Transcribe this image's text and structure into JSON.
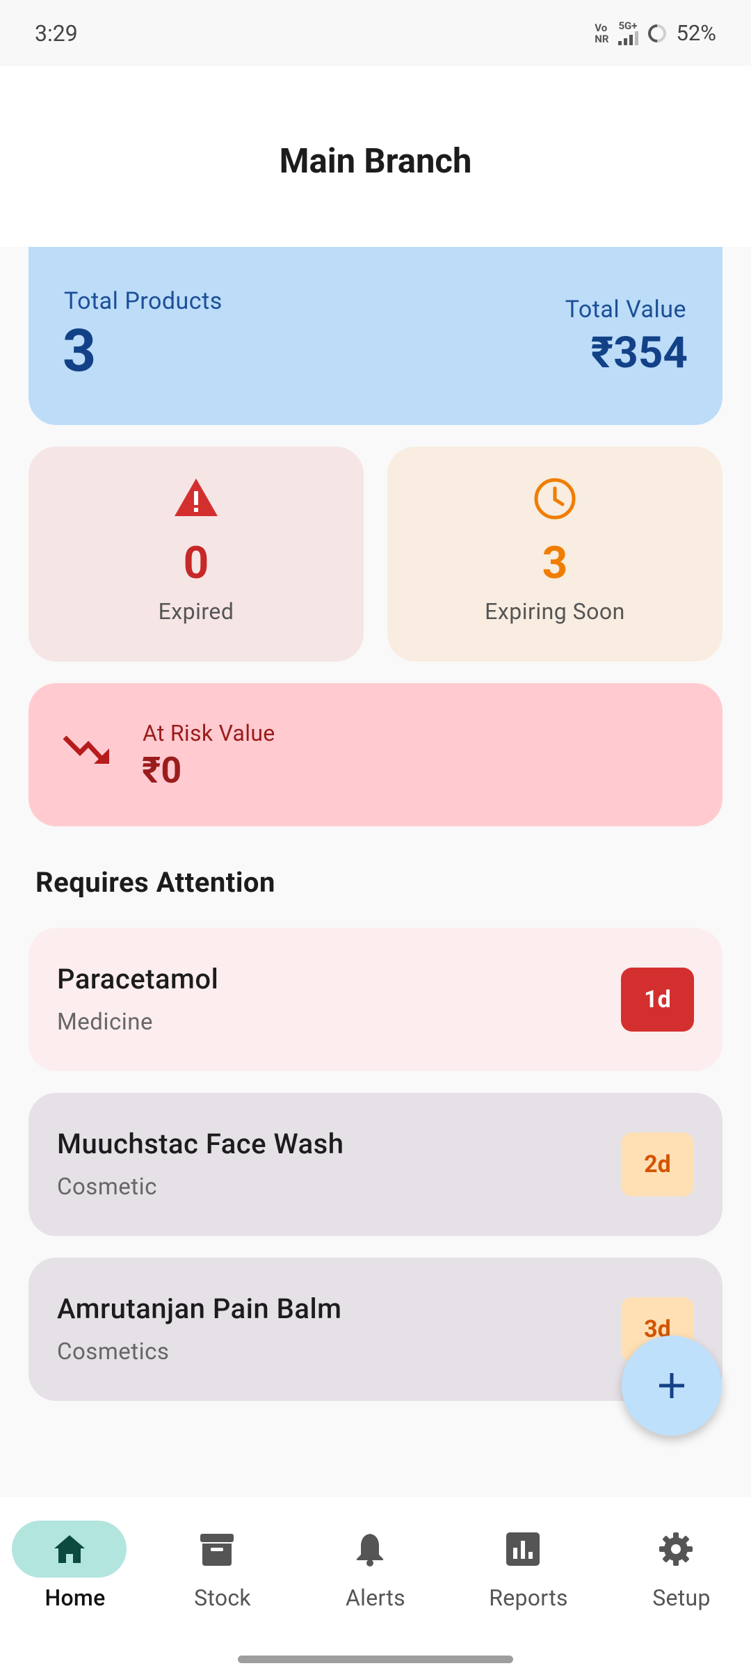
{
  "status_bar": {
    "time": "3:29",
    "net_top": "Vo",
    "net_bottom": "NR",
    "net_type": "5G+",
    "battery": "52%"
  },
  "header": {
    "title": "Main Branch"
  },
  "summary": {
    "total_products_label": "Total Products",
    "total_products": "3",
    "total_value_label": "Total Value",
    "total_value": "₹354"
  },
  "stats": {
    "expired": {
      "value": "0",
      "label": "Expired",
      "icon": "warning-triangle-icon",
      "color": "#c62828"
    },
    "expiring_soon": {
      "value": "3",
      "label": "Expiring Soon",
      "icon": "clock-icon",
      "color": "#ef7d00"
    }
  },
  "at_risk": {
    "label": "At Risk Value",
    "value": "₹0",
    "icon": "trending-down-icon"
  },
  "attention": {
    "title": "Requires Attention",
    "items": [
      {
        "name": "Paracetamol",
        "category": "Medicine",
        "badge": "1d"
      },
      {
        "name": "Muuchstac Face Wash",
        "category": "Cosmetic",
        "badge": "2d"
      },
      {
        "name": "Amrutanjan Pain Balm",
        "category": "Cosmetics",
        "badge": "3d"
      }
    ]
  },
  "fab": {
    "icon": "plus-icon"
  },
  "nav": {
    "items": [
      {
        "label": "Home",
        "icon": "home-icon",
        "active": true
      },
      {
        "label": "Stock",
        "icon": "archive-box-icon",
        "active": false
      },
      {
        "label": "Alerts",
        "icon": "bell-icon",
        "active": false
      },
      {
        "label": "Reports",
        "icon": "bar-chart-icon",
        "active": false
      },
      {
        "label": "Setup",
        "icon": "gear-icon",
        "active": false
      }
    ]
  },
  "colors": {
    "accent_blue": "#134188",
    "danger": "#c62828",
    "warning": "#ef7d00",
    "nav_active": "#b3e5df"
  }
}
